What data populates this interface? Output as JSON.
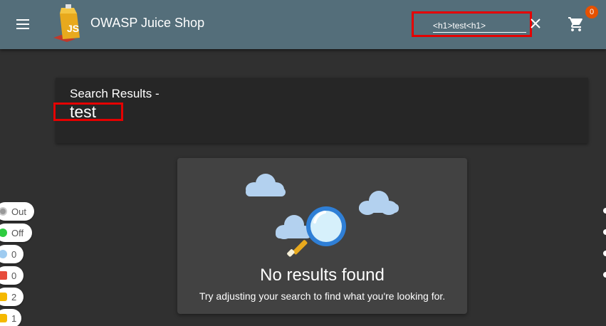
{
  "header": {
    "app_title": "OWASP Juice Shop",
    "search_value": "<h1>test<h1>",
    "cart_count": "0"
  },
  "results": {
    "label": "Search Results -",
    "term": "test"
  },
  "empty_state": {
    "title": "No results found",
    "subtitle": "Try adjusting your search to find what you're looking for."
  },
  "side_pills": [
    {
      "label": "Out",
      "icon": "target-icon",
      "color": "#888888"
    },
    {
      "label": "Off",
      "icon": "status-dot-icon",
      "color": "#2ecc40"
    },
    {
      "label": "0",
      "icon": "lightbulb-icon",
      "color": "#9ecbf0"
    },
    {
      "label": "0",
      "icon": "flag-icon",
      "color": "#e74c3c"
    },
    {
      "label": "2",
      "icon": "thumbs-up-icon",
      "color": "#f5b800"
    },
    {
      "label": "1",
      "icon": "thumbs-up-icon",
      "color": "#f5b800"
    }
  ],
  "colors": {
    "toolbar": "#546e7a",
    "background": "#303030",
    "highlight": "#e50000",
    "badge": "#e65100"
  }
}
